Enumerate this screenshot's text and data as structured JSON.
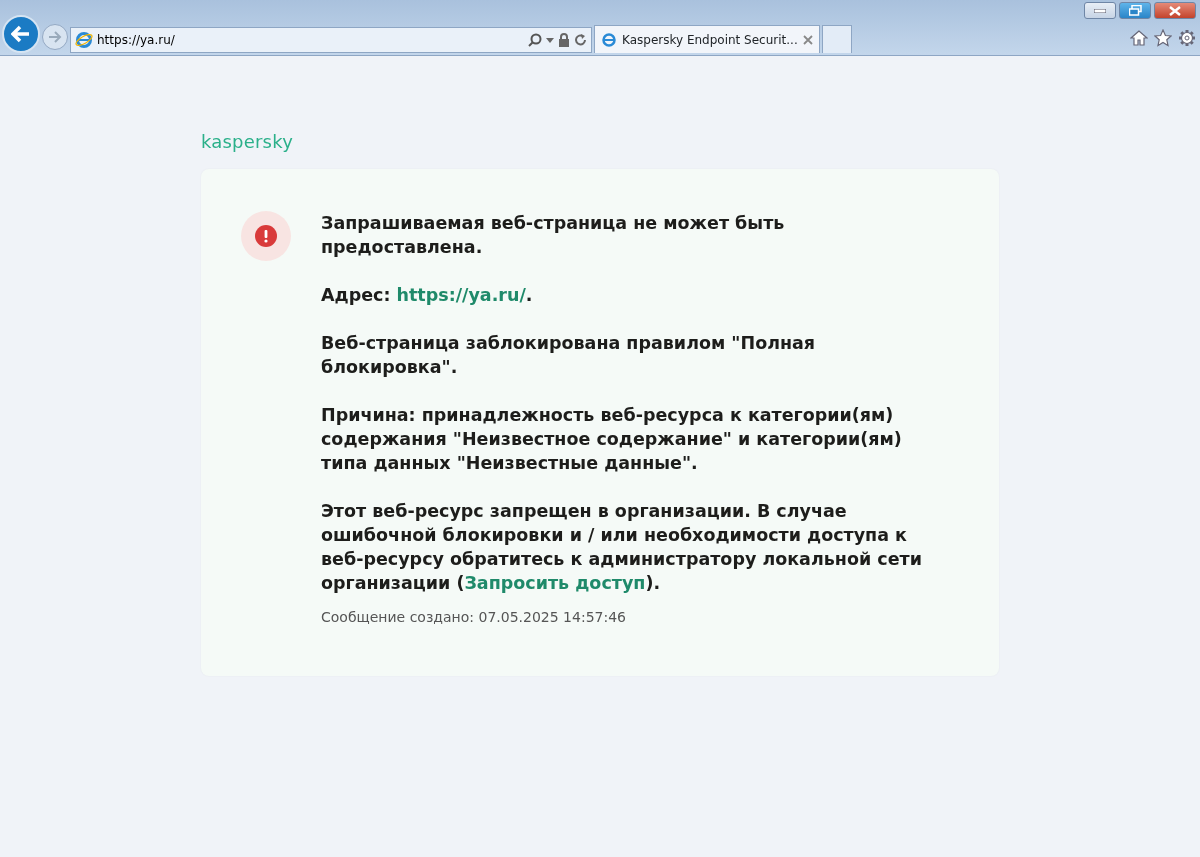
{
  "browser": {
    "address": "https://ya.ru/",
    "tabs": [
      {
        "title": "Kaspersky Endpoint Securit...",
        "selected": true
      }
    ]
  },
  "logo": "kaspersky",
  "message": {
    "paragraphs": [
      {
        "before": "Запрашиваемая веб-страница не может быть предоставлена."
      },
      {
        "before": "Адрес: ",
        "link": "https://ya.ru/",
        "after": "."
      },
      {
        "before": "Веб-страница заблокирована правилом \"Полная блокировка\"."
      },
      {
        "before": "Причина: принадлежность веб-ресурса к категории(ям) содержания \"Неизвестное содержание\" и категории(ям) типа данных \"Неизвестные данные\"."
      },
      {
        "before": "Этот веб-ресурс запрещен в организации. В случае ошибочной блокировки и / или необходимости доступа к веб-ресурсу обратитесь к администратору локальной сети организации (",
        "link": "Запросить доступ",
        "after": ")."
      }
    ],
    "footer": "Сообщение создано: 07.05.2025 14:57:46"
  }
}
